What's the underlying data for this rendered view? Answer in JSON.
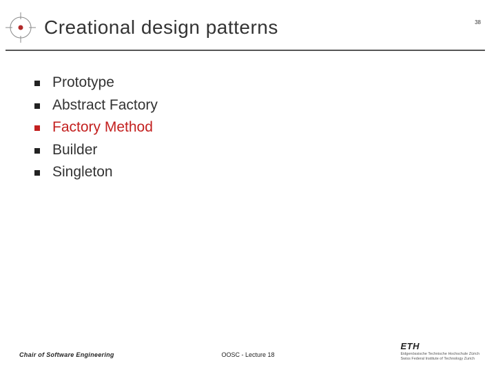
{
  "page_number": "38",
  "header": {
    "title": "Creational design patterns"
  },
  "bullets": [
    {
      "text": "Prototype",
      "highlight": false
    },
    {
      "text": "Abstract Factory",
      "highlight": false
    },
    {
      "text": "Factory Method",
      "highlight": true
    },
    {
      "text": "Builder",
      "highlight": false
    },
    {
      "text": "Singleton",
      "highlight": false
    }
  ],
  "footer": {
    "left": "Chair of Software Engineering",
    "center": "OOSC - Lecture 18",
    "brand": "ETH",
    "brand_sub1": "Eidgenössische Technische Hochschule Zürich",
    "brand_sub2": "Swiss Federal Institute of Technology Zurich"
  },
  "colors": {
    "accent_red": "#c3201f",
    "rule": "#555555"
  }
}
